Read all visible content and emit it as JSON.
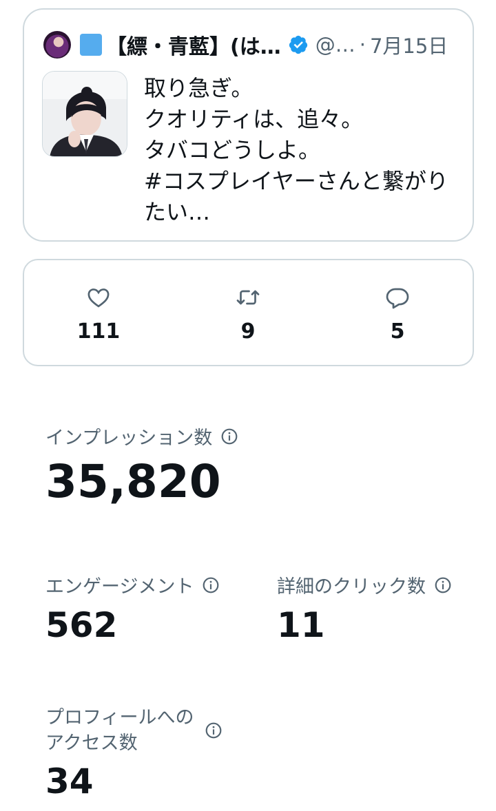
{
  "tweet": {
    "display_name": "【縹・青藍】(は…",
    "handle": "@…",
    "separator": "·",
    "date": "7月15日",
    "text_lines": [
      "取り急ぎ。",
      "クオリティは、追々。",
      "タバコどうしよ。",
      "#コスプレイヤーさんと繋がり",
      "たい…"
    ],
    "icons": {
      "avatar": "user-avatar",
      "name_badge": "blue-square-emoji",
      "verified": "verified-badge-icon",
      "media": "media-thumbnail"
    }
  },
  "engagement": {
    "likes": "111",
    "retweets": "9",
    "replies": "5",
    "icons": [
      "heart-icon",
      "retweet-icon",
      "reply-icon"
    ]
  },
  "metrics": {
    "impressions": {
      "label": "インプレッション数",
      "value": "35,820"
    },
    "engagements": {
      "label": "エンゲージメント",
      "value": "562"
    },
    "detail_clicks": {
      "label": "詳細のクリック数",
      "value": "11"
    },
    "profile_visits": {
      "label_lines": [
        "プロフィールへの",
        "アクセス数"
      ],
      "value": "34"
    }
  },
  "colors": {
    "text_primary": "#0f1419",
    "text_secondary": "#536471",
    "border": "#cfd9de",
    "verified_blue": "#1d9bf0",
    "square_blue": "#55acee"
  }
}
